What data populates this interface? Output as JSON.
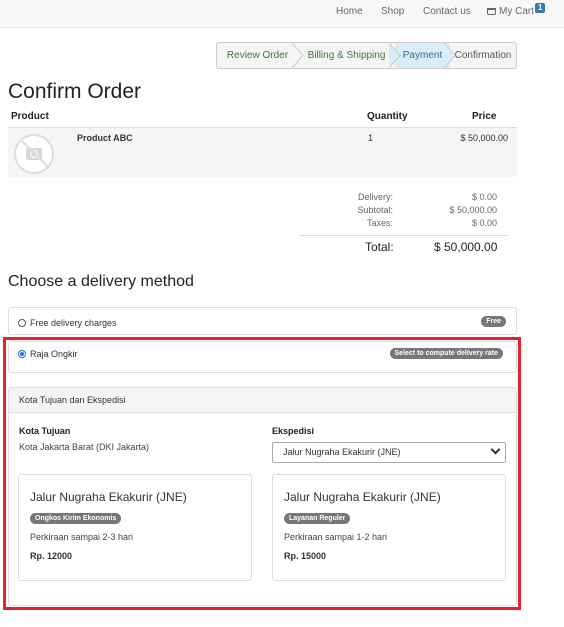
{
  "nav": {
    "home": "Home",
    "shop": "Shop",
    "contact": "Contact us",
    "cart": "My Cart",
    "cart_count": "1"
  },
  "steps": [
    "Review Order",
    "Billing & Shipping",
    "Payment",
    "Confirmation"
  ],
  "page_title": "Confirm Order",
  "table": {
    "headers": {
      "product": "Product",
      "quantity": "Quantity",
      "price": "Price"
    },
    "row": {
      "name": "Product ABC",
      "quantity": "1",
      "price": "$ 50,000.00"
    }
  },
  "summary": {
    "delivery_label": "Delivery:",
    "delivery_value": "$ 0.00",
    "subtotal_label": "Subtotal:",
    "subtotal_value": "$ 50,000.00",
    "taxes_label": "Taxes:",
    "taxes_value": "$ 0.00",
    "total_label": "Total:",
    "total_value": "$ 50,000.00"
  },
  "delivery": {
    "title": "Choose a delivery method",
    "options": [
      {
        "label": "Free delivery charges",
        "badge": "Free",
        "selected": false
      },
      {
        "label": "Raja Ongkir",
        "badge": "Select to compute delivery rate",
        "selected": true
      }
    ],
    "panel": {
      "header": "Kota Tujuan dan Ekspedisi",
      "city_label": "Kota Tujuan",
      "city_value": "Kota Jakarta Barat (DKI Jakarta)",
      "courier_label": "Ekspedisi",
      "courier_selected": "Jalur Nugraha Ekakurir (JNE)"
    },
    "services": [
      {
        "name": "Jalur Nugraha Ekakurir (JNE)",
        "badge": "Ongkos Kirim Ekonomis",
        "estimate": "Perkiraan sampai 2-3 hari",
        "price": "Rp. 12000"
      },
      {
        "name": "Jalur Nugraha Ekakurir (JNE)",
        "badge": "Layanan Reguler",
        "estimate": "Perkiraan sampai 1-2 hari",
        "price": "Rp. 15000"
      }
    ]
  },
  "colors": {
    "highlight_border": "#e5222d",
    "active_step_bg": "#d9edf7",
    "badge_bg": "#777777"
  }
}
